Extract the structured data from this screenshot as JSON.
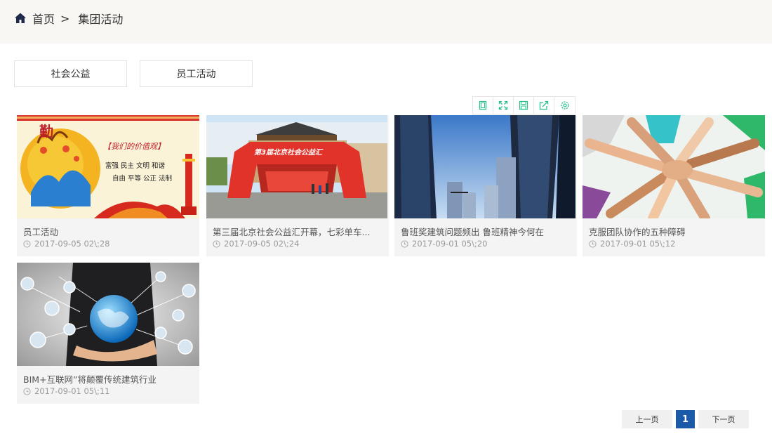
{
  "breadcrumb": {
    "home": "首页",
    "separator": ">",
    "current": "集团活动"
  },
  "tabs": [
    {
      "label": "社会公益"
    },
    {
      "label": "员工活动"
    }
  ],
  "toolbox": {
    "icons": [
      "restore-icon",
      "fullscreen-icon",
      "save-icon",
      "share-icon",
      "settings-icon"
    ],
    "color": "#2bbf8a"
  },
  "cards": [
    {
      "title": "员工活动",
      "date": "2017-09-05 02\\;28"
    },
    {
      "title": "第三届北京社会公益汇开幕，七彩单车...",
      "date": "2017-09-05 02\\;24"
    },
    {
      "title": "鲁班奖建筑问题频出 鲁班精神今何在",
      "date": "2017-09-01 05\\;20"
    },
    {
      "title": "克服团队协作的五种障碍",
      "date": "2017-09-01 05\\;12"
    },
    {
      "title": "BIM+互联网”将颠覆传统建筑行业",
      "date": "2017-09-01 05\\;11"
    }
  ],
  "thumbs": {
    "poster_slogan": "【我们的价值观】",
    "poster_line1": "富强 民主 文明 和谐",
    "poster_line2": "自由 平等 公正 法制",
    "poster_char": "勤",
    "arch_text": "第3届北京社会公益汇"
  },
  "pager": {
    "prev": "上一页",
    "page": "1",
    "next": "下一页"
  }
}
